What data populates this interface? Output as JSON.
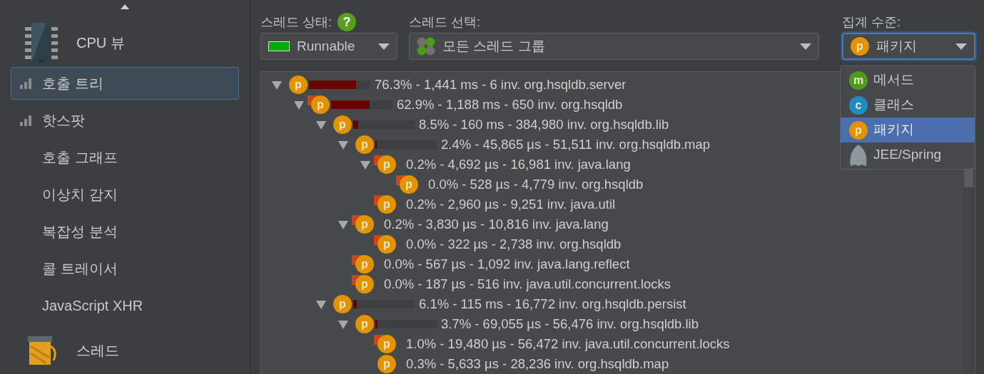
{
  "sidebar": {
    "sections": [
      {
        "title": "CPU 뷰",
        "kind": "chip",
        "items": [
          {
            "label": "호출 트리",
            "selected": true,
            "kind": "recorded"
          },
          {
            "label": "핫스팟",
            "selected": false,
            "kind": "recorded"
          },
          {
            "label": "호출 그래프",
            "selected": false,
            "kind": "plain"
          },
          {
            "label": "이상치 감지",
            "selected": false,
            "kind": "plain"
          },
          {
            "label": "복잡성 분석",
            "selected": false,
            "kind": "plain"
          },
          {
            "label": "콜 트레이서",
            "selected": false,
            "kind": "plain"
          },
          {
            "label": "JavaScript XHR",
            "selected": false,
            "kind": "plain"
          }
        ]
      },
      {
        "title": "스레드",
        "kind": "spool"
      }
    ]
  },
  "toolbar": {
    "thread_state": {
      "label": "스레드 상태:",
      "help": "?",
      "value": "Runnable"
    },
    "thread_selection": {
      "label": "스레드 선택:",
      "value": "모든 스레드 그룹"
    },
    "aggregation": {
      "label": "집계 수준:",
      "badge": "p",
      "kind": "package",
      "value": "패키지",
      "expanded": true,
      "options": [
        {
          "badge": "m",
          "kind": "method",
          "label": "메서드",
          "selected": false
        },
        {
          "badge": "c",
          "kind": "class",
          "label": "클래스",
          "selected": false
        },
        {
          "badge": "p",
          "kind": "package",
          "label": "패키지",
          "selected": true
        },
        {
          "kind": "jee",
          "label": "JEE/Spring",
          "selected": false
        }
      ]
    }
  },
  "call_tree": [
    {
      "badge": "p",
      "text": "76.3% - 1,441 ms - 6 inv. org.hsqldb.server",
      "expanded": true,
      "flagged": false,
      "level": 0.763,
      "children": [
        {
          "badge": "p",
          "text": "62.9% - 1,188 ms - 650 inv. org.hsqldb",
          "expanded": true,
          "flagged": true,
          "level": 0.629,
          "children": [
            {
              "badge": "p",
              "text": "8.5% - 160 ms - 384,980 inv. org.hsqldb.lib",
              "expanded": true,
              "flagged": false,
              "level": 0.085,
              "children": [
                {
                  "badge": "p",
                  "text": "2.4% - 45,865 µs - 51,511 inv. org.hsqldb.map",
                  "expanded": true,
                  "flagged": false,
                  "level": 0.024,
                  "children": [
                    {
                      "badge": "p",
                      "text": "0.2% - 4,692 µs - 16,981 inv. java.lang",
                      "expanded": true,
                      "flagged": true,
                      "children": [
                        {
                          "badge": "p",
                          "text": "0.0% - 528 µs - 4,779 inv. org.hsqldb",
                          "flagged": true
                        }
                      ]
                    },
                    {
                      "badge": "p",
                      "text": "0.2% - 2,960 µs - 9,251 inv. java.util",
                      "flagged": true
                    }
                  ]
                },
                {
                  "badge": "p",
                  "text": "0.2% - 3,830 µs - 10,816 inv. java.lang",
                  "expanded": true,
                  "flagged": true,
                  "children": [
                    {
                      "badge": "p",
                      "text": "0.0% - 322 µs - 2,738 inv. org.hsqldb",
                      "flagged": true
                    }
                  ]
                },
                {
                  "badge": "p",
                  "text": "0.0% - 567 µs - 1,092 inv. java.lang.reflect",
                  "flagged": true
                },
                {
                  "badge": "p",
                  "text": "0.0% - 187 µs - 516 inv. java.util.concurrent.locks",
                  "flagged": true
                }
              ]
            },
            {
              "badge": "p",
              "text": "6.1% - 115 ms - 16,772 inv. org.hsqldb.persist",
              "expanded": true,
              "flagged": false,
              "level": 0.061,
              "children": [
                {
                  "badge": "p",
                  "text": "3.7% - 69,055 µs - 56,476 inv. org.hsqldb.lib",
                  "expanded": true,
                  "flagged": false,
                  "level": 0.037,
                  "children": [
                    {
                      "badge": "p",
                      "text": "1.0% - 19,480 µs - 56,472 inv. java.util.concurrent.locks",
                      "flagged": true
                    },
                    {
                      "badge": "p",
                      "text": "0.3% - 5,633 µs - 28,236 inv. org.hsqldb.map",
                      "flagged": false
                    }
                  ]
                }
              ]
            }
          ]
        }
      ]
    }
  ]
}
